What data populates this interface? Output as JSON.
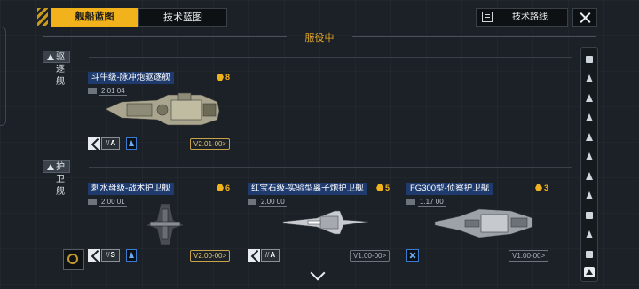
{
  "header": {
    "tab_active": "舰船蓝图",
    "tab_inactive": "技术蓝图",
    "tech_route_label": "技术路线",
    "close_icon": "close-icon"
  },
  "status": "服役中",
  "sections": [
    {
      "title": "驱逐舰",
      "cards": [
        {
          "name": "斗牛级-脉冲炮驱逐舰",
          "version": "2.01 04",
          "count": "8",
          "grade": "A",
          "version_tag": "V2.01-00>"
        }
      ]
    },
    {
      "title": "护卫舰",
      "cards": [
        {
          "name": "刺水母级-战术护卫舰",
          "version": "2.00 01",
          "count": "6",
          "grade": "S",
          "version_tag": "V2.00-00>"
        },
        {
          "name": "红宝石级-实验型离子炮护卫舰",
          "version": "2.00 00",
          "count": "5",
          "grade": "A",
          "version_tag": "V1.00-00>"
        },
        {
          "name": "FG300型-侦察护卫舰",
          "version": "1.17 00",
          "count": "3",
          "grade": "",
          "version_tag": "V1.00-00>"
        }
      ]
    }
  ],
  "colors": {
    "accent": "#f2b21b",
    "name_bg": "#1f3b6e",
    "background": "#1c2127"
  }
}
